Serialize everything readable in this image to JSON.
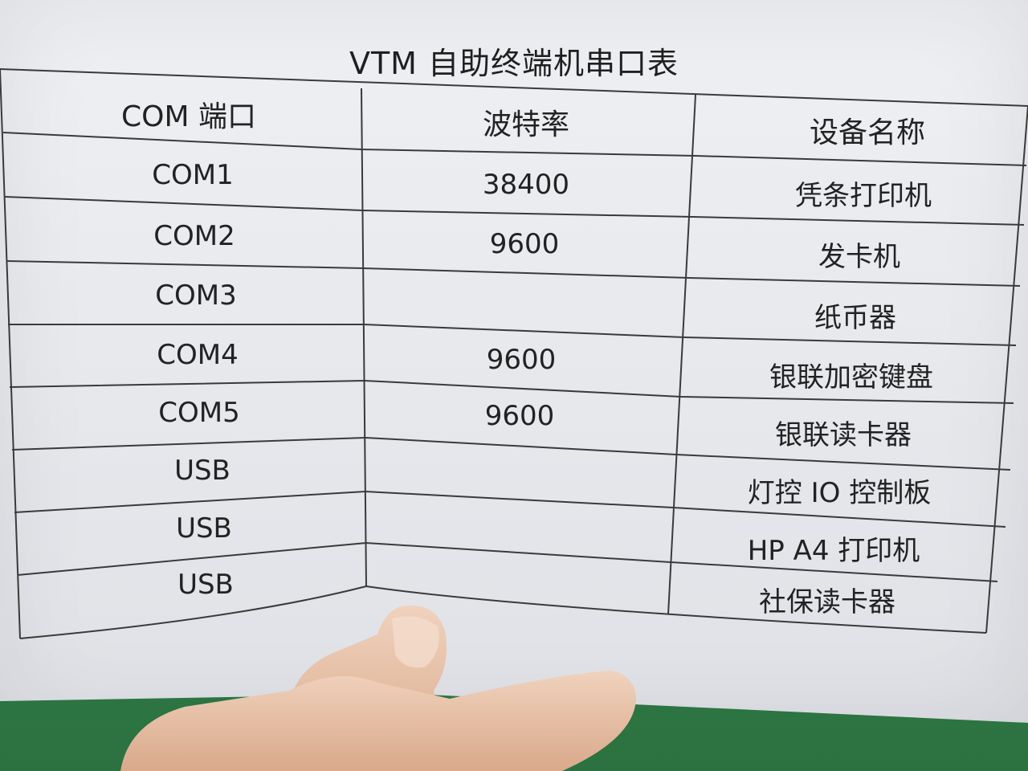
{
  "title": "VTM 自助终端机串口表",
  "table": {
    "headers": [
      "COM 端口",
      "波特率",
      "设备名称"
    ],
    "rows": [
      {
        "port": "COM1",
        "baud": "38400",
        "device": "凭条打印机"
      },
      {
        "port": "COM2",
        "baud": "9600",
        "device": "发卡机"
      },
      {
        "port": "COM3",
        "baud": "",
        "device": "纸币器"
      },
      {
        "port": "COM4",
        "baud": "9600",
        "device": "银联加密键盘"
      },
      {
        "port": "COM5",
        "baud": "9600",
        "device": "银联读卡器"
      },
      {
        "port": "USB",
        "baud": "",
        "device": "灯控 IO 控制板"
      },
      {
        "port": "USB",
        "baud": "",
        "device": "HP A4 打印机"
      },
      {
        "port": "USB",
        "baud": "",
        "device": "社保读卡器"
      }
    ]
  },
  "colors": {
    "paper": "#e8eaee",
    "ink": "#222222",
    "background": "#2f7a45",
    "skin": "#e8c2a6"
  }
}
